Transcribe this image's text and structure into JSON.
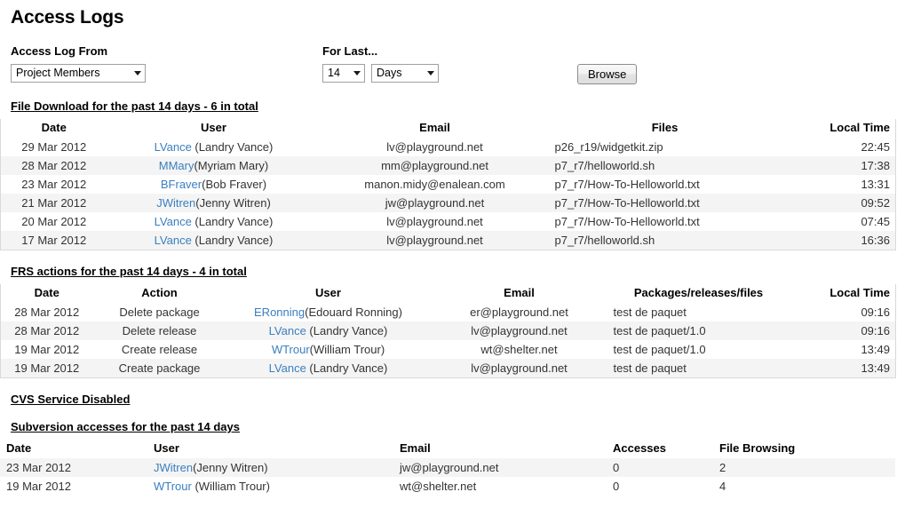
{
  "page": {
    "title": "Access Logs"
  },
  "form": {
    "from_label": "Access Log From",
    "from_value": "Project Members",
    "forlast_label": "For Last...",
    "count_value": "14",
    "unit_value": "Days",
    "browse_label": "Browse"
  },
  "download": {
    "heading": "File Download for the past 14 days - 6 in total",
    "columns": [
      "Date",
      "User",
      "Email",
      "Files",
      "Local Time"
    ],
    "rows": [
      {
        "date": "29 Mar 2012",
        "user_login": "LVance",
        "user_real": " (Landry Vance)",
        "email": "lv@playground.net",
        "file": "p26_r19/widgetkit.zip",
        "time": "22:45"
      },
      {
        "date": "28 Mar 2012",
        "user_login": "MMary",
        "user_real": "(Myriam Mary)",
        "email": "mm@playground.net",
        "file": "p7_r7/helloworld.sh",
        "time": "17:38"
      },
      {
        "date": "23 Mar 2012",
        "user_login": "BFraver",
        "user_real": "(Bob Fraver)",
        "email": "manon.midy@enalean.com",
        "file": "p7_r7/How-To-Helloworld.txt",
        "time": "13:31"
      },
      {
        "date": "21 Mar 2012",
        "user_login": "JWitren",
        "user_real": "(Jenny Witren)",
        "email": "jw@playground.net",
        "file": "p7_r7/How-To-Helloworld.txt",
        "time": "09:52"
      },
      {
        "date": "20 Mar 2012",
        "user_login": "LVance",
        "user_real": " (Landry Vance)",
        "email": "lv@playground.net",
        "file": "p7_r7/How-To-Helloworld.txt",
        "time": "07:45"
      },
      {
        "date": "17 Mar 2012",
        "user_login": "LVance",
        "user_real": " (Landry Vance)",
        "email": "lv@playground.net",
        "file": "p7_r7/helloworld.sh",
        "time": "16:36"
      }
    ]
  },
  "frs": {
    "heading": "FRS actions for the past 14 days - 4 in total",
    "columns": [
      "Date",
      "Action",
      "User",
      "Email",
      "Packages/releases/files",
      "Local Time"
    ],
    "rows": [
      {
        "date": "28 Mar 2012",
        "action": "Delete package",
        "user_login": "ERonning",
        "user_real": "(Edouard Ronning)",
        "email": "er@playground.net",
        "item": "test de paquet",
        "time": "09:16"
      },
      {
        "date": "28 Mar 2012",
        "action": "Delete release",
        "user_login": "LVance",
        "user_real": " (Landry Vance)",
        "email": "lv@playground.net",
        "item": "test de paquet/1.0",
        "time": "09:16"
      },
      {
        "date": "19 Mar 2012",
        "action": "Create release",
        "user_login": "WTrour",
        "user_real": "(William Trour)",
        "email": "wt@shelter.net",
        "item": "test de paquet/1.0",
        "time": "13:49"
      },
      {
        "date": "19 Mar 2012",
        "action": "Create package",
        "user_login": "LVance",
        "user_real": " (Landry Vance)",
        "email": "lv@playground.net",
        "item": "test de paquet",
        "time": "13:49"
      }
    ]
  },
  "cvs": {
    "heading": "CVS Service Disabled"
  },
  "svn": {
    "heading": "Subversion accesses for the past 14 days",
    "columns": [
      "Date",
      "User",
      "Email",
      "Accesses",
      "File Browsing"
    ],
    "rows": [
      {
        "date": "23 Mar 2012",
        "user_login": "JWitren",
        "user_real": "(Jenny Witren)",
        "email": "jw@playground.net",
        "accesses": "0",
        "browsing": "2"
      },
      {
        "date": "19 Mar 2012",
        "user_login": "WTrour",
        "user_real": " (William Trour)",
        "email": "wt@shelter.net",
        "accesses": "0",
        "browsing": "4"
      }
    ]
  },
  "colors": {
    "link": "#3a7fbf",
    "stripe": "#f4f4f4",
    "text": "#333333"
  }
}
